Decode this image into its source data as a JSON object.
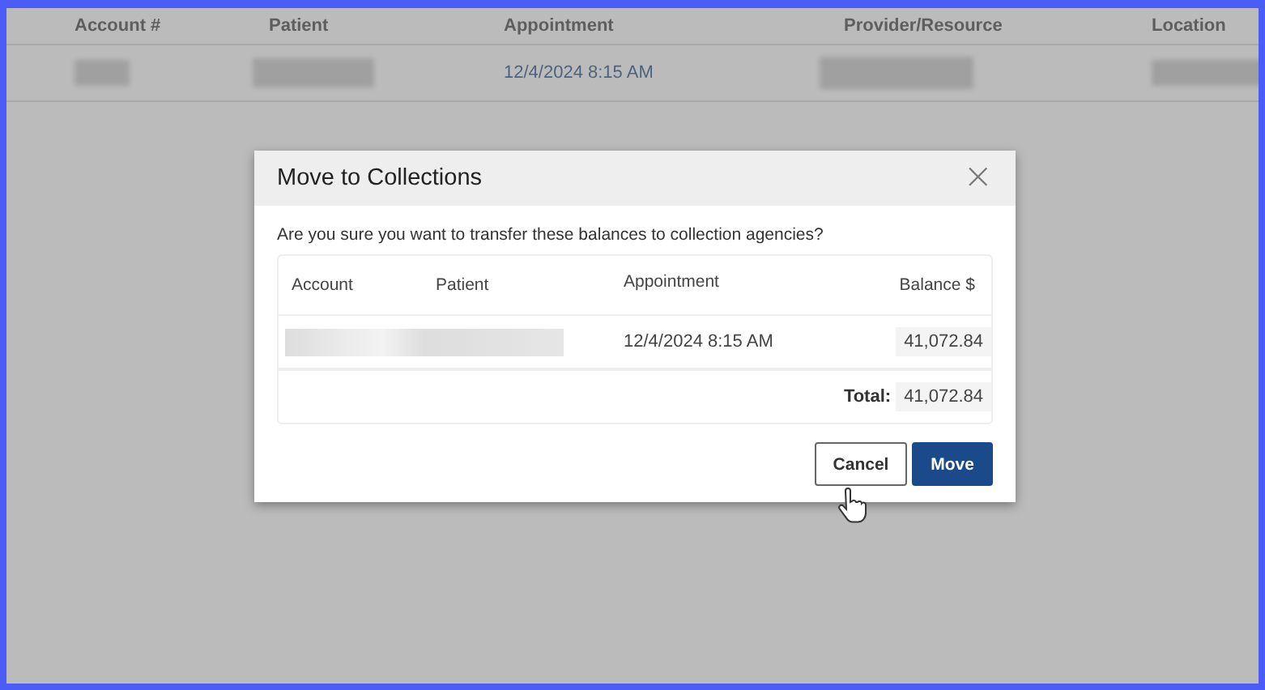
{
  "background_table": {
    "columns": [
      "Account #",
      "Patient",
      "Appointment",
      "Provider/Resource",
      "Location"
    ],
    "rows": [
      {
        "appointment": "12/4/2024 8:15 AM"
      }
    ]
  },
  "dialog": {
    "title": "Move to Collections",
    "close": "×",
    "message": "Are you sure you want to transfer these balances to collection agencies?",
    "table": {
      "columns": [
        "Account",
        "Patient",
        "Appointment",
        "Balance $"
      ],
      "rows": [
        {
          "appointment": "12/4/2024 8:15  AM",
          "balance": "41,072.84"
        }
      ],
      "total_label": "Total:",
      "total": "41,072.84"
    },
    "buttons": [
      {
        "label": "Cancel",
        "kind": "secondary"
      },
      {
        "label": "Move",
        "kind": "primary"
      }
    ]
  }
}
